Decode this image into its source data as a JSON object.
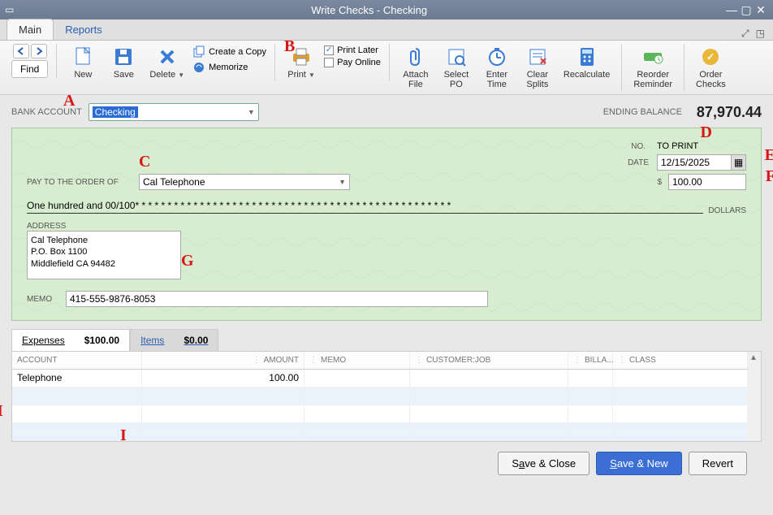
{
  "window": {
    "title": "Write Checks - Checking"
  },
  "tabs": {
    "main": "Main",
    "reports": "Reports"
  },
  "toolbar": {
    "find": "Find",
    "new": "New",
    "save": "Save",
    "delete": "Delete",
    "create_copy": "Create a Copy",
    "memorize": "Memorize",
    "print": "Print",
    "print_later": "Print Later",
    "pay_online": "Pay Online",
    "attach_file": "Attach\nFile",
    "select_po": "Select\nPO",
    "enter_time": "Enter\nTime",
    "clear_splits": "Clear\nSplits",
    "recalculate": "Recalculate",
    "reorder_reminder": "Reorder\nReminder",
    "order_checks": "Order\nChecks"
  },
  "top": {
    "bank_account_label": "BANK ACCOUNT",
    "bank_account_value": "Checking",
    "ending_balance_label": "ENDING BALANCE",
    "ending_balance_value": "87,970.44"
  },
  "check": {
    "no_label": "NO.",
    "no_value": "TO PRINT",
    "date_label": "DATE",
    "date_value": "12/15/2025",
    "payto_label": "PAY TO THE ORDER OF",
    "payto_value": "Cal Telephone",
    "dollar_sign": "$",
    "amount": "100.00",
    "amount_words": "One hundred and 00/100* * * * * * * * * * * * * * * * * * * * * * * * * * * * * * * * * * * * * * * * * * * * * * * * *",
    "dollars_label": "DOLLARS",
    "address_label": "ADDRESS",
    "address": "Cal Telephone\nP.O. Box 1100\nMiddlefield CA 94482",
    "memo_label": "MEMO",
    "memo_value": "415-555-9876-8053"
  },
  "detail_tabs": {
    "expenses_label": "Expenses",
    "expenses_amount": "$100.00",
    "items_label": "Items",
    "items_amount": "$0.00"
  },
  "grid": {
    "headers": {
      "account": "ACCOUNT",
      "amount": "AMOUNT",
      "memo": "MEMO",
      "customer": "CUSTOMER:JOB",
      "billable": "BILLA...",
      "class": "CLASS"
    },
    "rows": [
      {
        "account": "Telephone",
        "amount": "100.00",
        "memo": "",
        "customer": "",
        "billable": "",
        "class": ""
      }
    ]
  },
  "footer": {
    "save_close": "Save & Close",
    "save_new": "Save & New",
    "revert": "Revert"
  },
  "annotations": {
    "A": "A",
    "B": "B",
    "C": "C",
    "D": "D",
    "E": "E",
    "F": "F",
    "G": "G",
    "H": "H",
    "I": "I"
  }
}
